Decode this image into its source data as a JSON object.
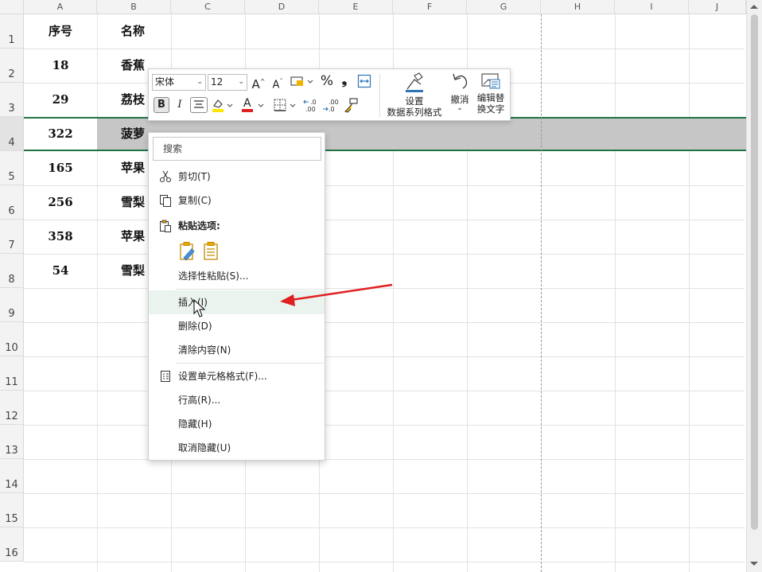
{
  "columns": [
    "A",
    "B",
    "C",
    "D",
    "E",
    "F",
    "G",
    "H",
    "I",
    "J"
  ],
  "rows": [
    "1",
    "2",
    "3",
    "4",
    "5",
    "6",
    "7",
    "8",
    "9",
    "10",
    "11",
    "12",
    "13",
    "14",
    "15",
    "16"
  ],
  "cells": {
    "header": {
      "a": "序号",
      "b": "名称"
    },
    "data": [
      {
        "a": "18",
        "b": "香蕉"
      },
      {
        "a": "29",
        "b": "荔枝"
      },
      {
        "a": "322",
        "b": "菠萝"
      },
      {
        "a": "165",
        "b": "苹果"
      },
      {
        "a": "256",
        "b": "雪梨"
      },
      {
        "a": "358",
        "b": "苹果"
      },
      {
        "a": "54",
        "b": "雪梨"
      }
    ]
  },
  "minibar": {
    "font_name": "宋体",
    "font_size": "12",
    "grow_font": "A",
    "shrink_font": "A",
    "percent": "%",
    "comma": "❟",
    "bold": "B",
    "italic": "I",
    "font_color_letter": "A",
    "decimal_increase": "←.0\n.00",
    "format_series_line1": "设置",
    "format_series_line2": "数据系列格式",
    "undo_label": "撤消",
    "alt_text_line1": "编辑替",
    "alt_text_line2": "换文字"
  },
  "context_menu": {
    "search_placeholder": "搜索",
    "cut": "剪切(T)",
    "copy": "复制(C)",
    "paste_options": "粘贴选项:",
    "paste_special": "选择性粘贴(S)...",
    "insert": "插入(I)",
    "delete": "删除(D)",
    "clear_contents": "清除内容(N)",
    "format_cells": "设置单元格格式(F)...",
    "row_height": "行高(R)...",
    "hide": "隐藏(H)",
    "unhide": "取消隐藏(U)"
  },
  "colors": {
    "selection_border": "#217346",
    "selected_row_fill": "#c6c6c6",
    "arrow": "#e02020",
    "menu_highlight": "#eaf3ee"
  }
}
